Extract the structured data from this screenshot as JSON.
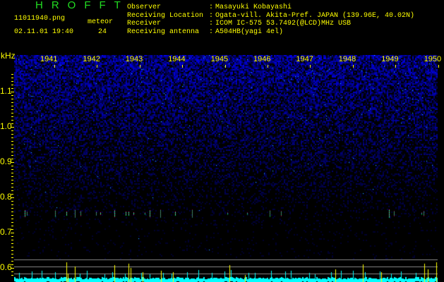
{
  "header": {
    "title": "HROFFT",
    "filename": "11011940.png",
    "datetime": "02.11.01 19:40",
    "meteor_label": "meteor",
    "meteor_count": "24",
    "info": [
      {
        "label": "Observer",
        "sep": ":",
        "value": "Masayuki Kobayashi"
      },
      {
        "label": "Receiving Location",
        "sep": ":",
        "value": "Ogata-vill. Akita-Pref. JAPAN (139.96E, 40.02N)"
      },
      {
        "label": "Receiver",
        "sep": ":",
        "value": "ICOM IC-575 53.7492(@LCD)MHz USB"
      },
      {
        "label": "Receiving antenna",
        "sep": ":",
        "value": "A504HB(yagi 4el)"
      }
    ]
  },
  "chart_data": {
    "type": "heatmap",
    "title": "HROFFT",
    "ylabel": "kHz",
    "y_ticks": [
      "1.1",
      "1.0",
      "0.9",
      "0.8",
      "0.7",
      "0.6"
    ],
    "ylim": [
      0.58,
      1.16
    ],
    "x_ticks": [
      "1941",
      "1942",
      "1943",
      "1944",
      "1945",
      "1946",
      "1947",
      "1948",
      "1949",
      "1950"
    ],
    "echo_frequency_khz": 0.755,
    "colors": {
      "noise": "#1a1aff",
      "echo_low": "#00ffff",
      "echo_high": "#ff0080",
      "count_bar": "#00ffff",
      "meteor_bar": "#ffff00"
    }
  }
}
